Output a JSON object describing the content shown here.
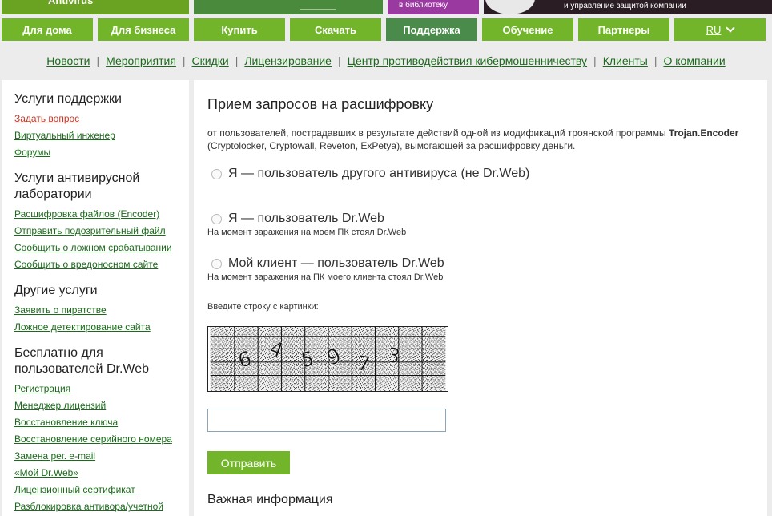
{
  "banner": {
    "left_text": "Antivirus",
    "library_text": "в библиотеку",
    "company_text": "и управление защитой компании"
  },
  "nav": {
    "items": [
      "Для дома",
      "Для бизнеса",
      "Купить",
      "Скачать",
      "Поддержка",
      "Обучение",
      "Партнеры"
    ],
    "active_index": 4,
    "lang": "RU"
  },
  "subnav": [
    "Новости",
    "Мероприятия",
    "Скидки",
    "Лицензирование",
    "Центр противодействия кибермошенничеству",
    "Клиенты",
    "О компании"
  ],
  "sidebar": {
    "sections": [
      {
        "title": "Услуги поддержки",
        "links": [
          "Задать вопрос",
          "Виртуальный инженер",
          "Форумы"
        ]
      },
      {
        "title": "Услуги антивирусной лаборатории",
        "links": [
          "Расшифровка файлов (Encoder)",
          "Отправить подозрительный файл",
          "Сообщить о ложном срабатывании",
          "Сообщить о вредоносном сайте"
        ]
      },
      {
        "title": "Другие услуги",
        "links": [
          "Заявить о пиратстве",
          "Ложное детектирование сайта"
        ]
      },
      {
        "title": "Бесплатно для пользователей Dr.Web",
        "links": [
          "Регистрация",
          "Менеджер лицензий",
          "Восстановление ключа",
          "Восстановление серийного номера",
          "Замена рег. e-mail",
          "«Мой Dr.Web»",
          "Лицензионный сертификат",
          "Разблокировка антивора/учетной"
        ]
      }
    ]
  },
  "main": {
    "title": "Прием запросов на расшифровку",
    "intro_pre": "от пользователей, пострадавших в результате действий одной из модификаций троянской программы ",
    "intro_bold": "Trojan.Encoder",
    "intro_post": " (Cryptolocker, Cryptowall, Reveton, ExPetya), вымогающей за расшифровку деньги.",
    "options": [
      {
        "label": "Я — пользователь другого антивируса (не Dr.Web)",
        "note": ""
      },
      {
        "label": "Я — пользователь Dr.Web",
        "note": "На момент заражения на моем ПК стоял Dr.Web"
      },
      {
        "label": "Мой клиент — пользователь Dr.Web",
        "note": "На момент заражения на ПК моего клиента стоял Dr.Web"
      }
    ],
    "captcha_label": "Введите строку с картинки:",
    "captcha_chars": [
      "6",
      "4",
      "5",
      "9",
      "7",
      "3"
    ],
    "captcha_value": "",
    "submit_label": "Отправить",
    "important_heading": "Важная информация"
  },
  "colors": {
    "nav_green": "#72b52a",
    "nav_active": "#4a8a4a",
    "link_green": "#1a6b1a",
    "link_red": "#c0392b",
    "page_bg": "#ececec"
  }
}
